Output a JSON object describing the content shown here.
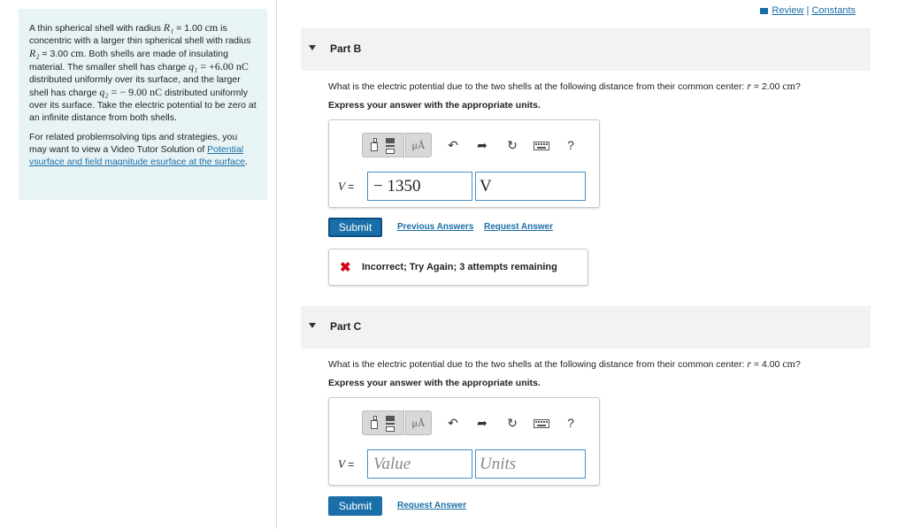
{
  "header": {
    "review_label": "Review",
    "separator": "|",
    "constants_label": "Constants"
  },
  "problem": {
    "para1": {
      "t1": "A thin spherical shell with radius ",
      "r1_sym": "R₁",
      "t2": " = 1.00 ",
      "cm1": "cm",
      "t3": " is concentric with a larger thin spherical shell with radius ",
      "r2_sym": "R₂",
      "t4": " = 3.00 ",
      "cm2": "cm",
      "t5": ". Both shells are made of insulating material. The smaller shell has charge ",
      "q1_sym": "q₁",
      "t6": " = +6.00 ",
      "nc1": "nC",
      "t7": " distributed uniformly over its surface, and the larger shell has charge ",
      "q2_sym": "q₂",
      "t8": " = − 9.00 ",
      "nc2": "nC",
      "t9": " distributed uniformly over its surface. Take the electric potential to be zero at an infinite distance from both shells."
    },
    "para2_text": "For related problemsolving tips and strategies, you may want to view a Video Tutor Solution of ",
    "para2_link": "Potential vsurface and field magnitude esurface at the surface",
    "para2_end": "."
  },
  "partB": {
    "label": "Part B",
    "question_prefix": "What is the electric potential due to the two shells at the following distance from their common center: ",
    "question_var": "r",
    "question_val": " = 2.00 ",
    "question_unit": "cm",
    "question_end": "?",
    "instruction": "Express your answer with the appropriate units.",
    "v_label": "V",
    "equals": " =",
    "value": "− 1350",
    "units": "V",
    "submit_label": "Submit",
    "previous_answers": "Previous Answers",
    "request_answer": "Request Answer",
    "feedback": "Incorrect; Try Again; 3 attempts remaining"
  },
  "partC": {
    "label": "Part C",
    "question_prefix": "What is the electric potential due to the two shells at the following distance from their common center: ",
    "question_var": "r",
    "question_val": " = 4.00 ",
    "question_unit": "cm",
    "question_end": "?",
    "instruction": "Express your answer with the appropriate units.",
    "v_label": "V",
    "equals": " =",
    "value_placeholder": "Value",
    "units_placeholder": "Units",
    "submit_label": "Submit",
    "request_answer": "Request Answer"
  },
  "toolbar": {
    "units_btn": "μÅ",
    "help": "?"
  }
}
